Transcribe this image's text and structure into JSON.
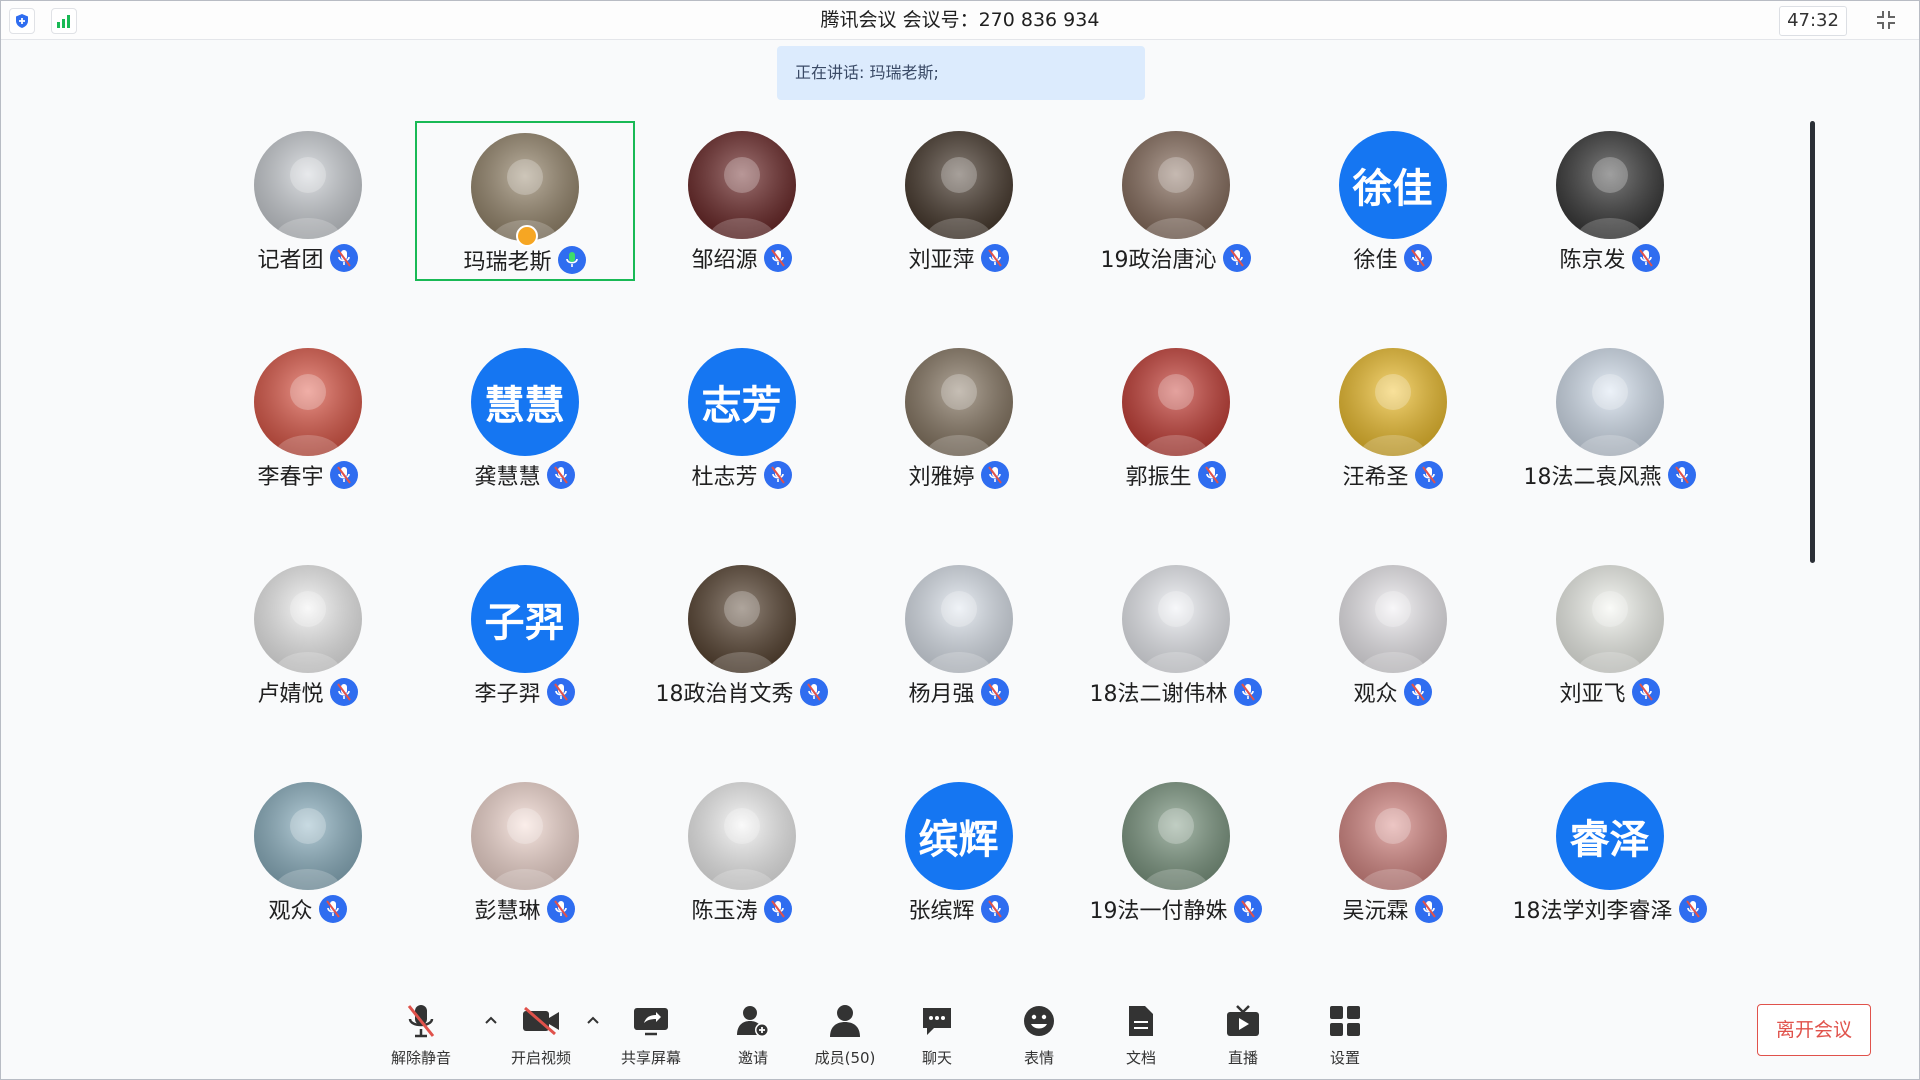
{
  "titlebar": {
    "title": "腾讯会议 会议号：270 836 934",
    "timer": "47:32"
  },
  "speaking": "正在讲话: 玛瑞老斯;",
  "participants": [
    {
      "name": "记者团",
      "avatar_text": "",
      "avatar_bg": "#cfd3d8"
    },
    {
      "name": "玛瑞老斯",
      "avatar_text": "",
      "avatar_bg": "#9a8a70",
      "speaking": true
    },
    {
      "name": "邹绍源",
      "avatar_text": "",
      "avatar_bg": "#6e2a2a"
    },
    {
      "name": "刘亚萍",
      "avatar_text": "",
      "avatar_bg": "#4a3c30"
    },
    {
      "name": "19政治唐沁",
      "avatar_text": "",
      "avatar_bg": "#8a7060"
    },
    {
      "name": "徐佳",
      "avatar_text": "徐佳",
      "avatar_bg": "#1576f2"
    },
    {
      "name": "陈京发",
      "avatar_text": "",
      "avatar_bg": "#3a3a3a"
    },
    {
      "name": "李春宇",
      "avatar_text": "",
      "avatar_bg": "#e05a4a"
    },
    {
      "name": "龚慧慧",
      "avatar_text": "慧慧",
      "avatar_bg": "#1576f2"
    },
    {
      "name": "杜志芳",
      "avatar_text": "志芳",
      "avatar_bg": "#1576f2"
    },
    {
      "name": "刘雅婷",
      "avatar_text": "",
      "avatar_bg": "#8a7a66"
    },
    {
      "name": "郭振生",
      "avatar_text": "",
      "avatar_bg": "#c84038"
    },
    {
      "name": "汪希圣",
      "avatar_text": "",
      "avatar_bg": "#f2c230"
    },
    {
      "name": "18法二袁风燕",
      "avatar_text": "",
      "avatar_bg": "#d8e4f2"
    },
    {
      "name": "卢婧悦",
      "avatar_text": "",
      "avatar_bg": "#f2f2f2"
    },
    {
      "name": "李子羿",
      "avatar_text": "子羿",
      "avatar_bg": "#1576f2"
    },
    {
      "name": "18政治肖文秀",
      "avatar_text": "",
      "avatar_bg": "#5a4634"
    },
    {
      "name": "杨月强",
      "avatar_text": "",
      "avatar_bg": "#dfe6ef"
    },
    {
      "name": "18法二谢伟林",
      "avatar_text": "",
      "avatar_bg": "#eef0f5"
    },
    {
      "name": "观众",
      "avatar_text": "",
      "avatar_bg": "#f0eef2"
    },
    {
      "name": "刘亚飞",
      "avatar_text": "",
      "avatar_bg": "#f4f6f0"
    },
    {
      "name": "观众",
      "avatar_text": "",
      "avatar_bg": "#8fb4c4"
    },
    {
      "name": "彭慧琳",
      "avatar_text": "",
      "avatar_bg": "#f6dcd4"
    },
    {
      "name": "陈玉涛",
      "avatar_text": "",
      "avatar_bg": "#f4f4f4"
    },
    {
      "name": "张缤辉",
      "avatar_text": "缤辉",
      "avatar_bg": "#1576f2"
    },
    {
      "name": "19法一付静姝",
      "avatar_text": "",
      "avatar_bg": "#7f9a84"
    },
    {
      "name": "吴沅霖",
      "avatar_text": "",
      "avatar_bg": "#d98a86"
    },
    {
      "name": "18法学刘李睿泽",
      "avatar_text": "睿泽",
      "avatar_bg": "#1576f2"
    }
  ],
  "toolbar": {
    "unmute": "解除静音",
    "video": "开启视频",
    "share": "共享屏幕",
    "invite": "邀请",
    "members": "成员(50)",
    "chat": "聊天",
    "emoji": "表情",
    "docs": "文档",
    "live": "直播",
    "settings": "设置",
    "leave": "离开会议"
  },
  "colors": {
    "accent": "#1576f2",
    "speaking_border": "#19b955",
    "leave": "#e0524b"
  }
}
